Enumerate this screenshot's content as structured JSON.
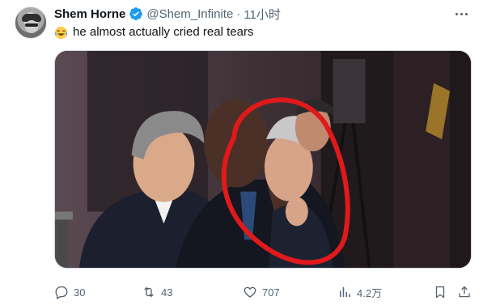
{
  "tweet": {
    "author_name": "Shem Horne",
    "handle": "@Shem_Infinite",
    "separator": "·",
    "time": "11小时",
    "text": "he almost actually cried real tears",
    "verified_color": "#1d9bf0",
    "highlight_color": "#e0191b"
  },
  "actions": {
    "reply_count": "30",
    "retweet_count": "43",
    "like_count": "707",
    "view_count": "4.2万"
  }
}
